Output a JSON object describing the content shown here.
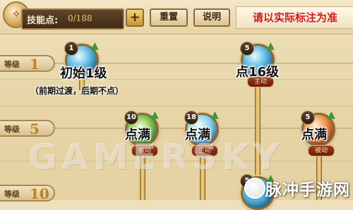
{
  "top_bar": {
    "skill_points_label": "技能点:",
    "skill_points_value": "0/188",
    "plus_label": "+",
    "reset_label": "重置",
    "help_label": "说明",
    "note_banner": "请以实际标注为准"
  },
  "levels": [
    {
      "word": "等级",
      "number": "1"
    },
    {
      "word": "等级",
      "number": "5"
    },
    {
      "word": "等级",
      "number": "10"
    }
  ],
  "skills": [
    {
      "rank": "1",
      "style": "ice",
      "annotation": "初始1级",
      "tag": ""
    },
    {
      "rank": "5",
      "style": "ice",
      "annotation": "点16级",
      "tag": "主动"
    },
    {
      "rank": "10",
      "style": "wind",
      "annotation": "点满",
      "tag": "被动"
    },
    {
      "rank": "18",
      "style": "frost",
      "annotation": "点满",
      "tag": "主动"
    },
    {
      "rank": "5",
      "style": "fire",
      "annotation": "点满",
      "tag": "被动"
    },
    {
      "rank": "5",
      "style": "ice",
      "annotation": "",
      "tag": ""
    }
  ],
  "annotation_note": "（前期过渡，后期不点）",
  "watermark": "GAMERSKY",
  "corner_watermark": "脉冲手游网"
}
